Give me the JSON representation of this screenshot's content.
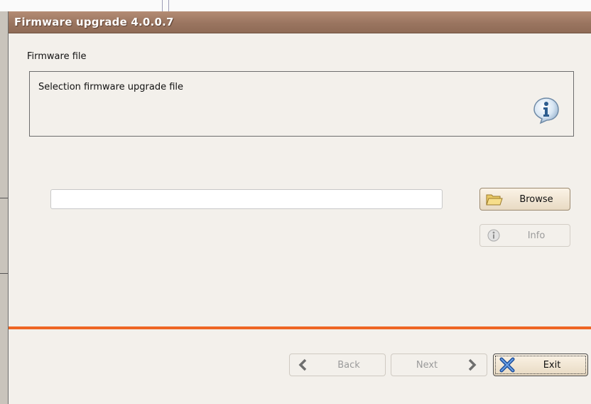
{
  "dialog": {
    "title": "Firmware upgrade 4.0.0.7"
  },
  "section": {
    "label": "Firmware file",
    "description": "Selection firmware upgrade file",
    "icon": "info-icon"
  },
  "file": {
    "value": "",
    "placeholder": ""
  },
  "buttons": {
    "browse": {
      "label": "Browse",
      "icon": "folder-icon",
      "enabled": true
    },
    "info": {
      "label": "Info",
      "icon": "info-icon",
      "enabled": false
    },
    "back": {
      "label": "Back",
      "icon": "chevron-left-icon",
      "enabled": false
    },
    "next": {
      "label": "Next",
      "icon": "chevron-right-icon",
      "enabled": false
    },
    "exit": {
      "label": "Exit",
      "icon": "close-icon",
      "enabled": true,
      "focused": true
    }
  },
  "colors": {
    "titlebar": "#9a7560",
    "accent_separator": "#ee6524",
    "dialog_background": "#f3f0eb",
    "disabled_text": "#9a9a9a"
  }
}
